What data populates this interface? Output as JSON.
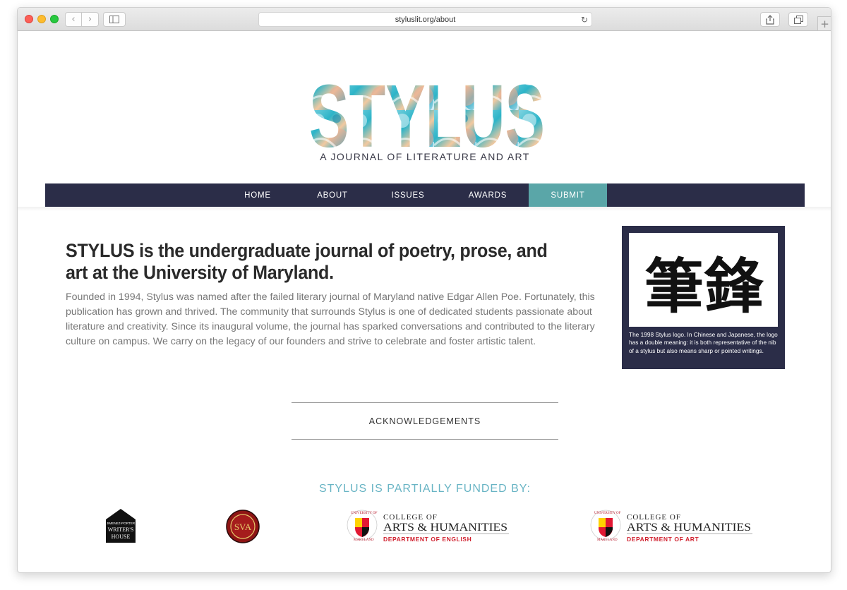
{
  "browser": {
    "url": "styluslit.org/about"
  },
  "header": {
    "logo_text": "STYLUS",
    "tagline": "A JOURNAL OF LITERATURE AND ART"
  },
  "nav": {
    "items": [
      {
        "label": "HOME"
      },
      {
        "label": "ABOUT"
      },
      {
        "label": "ISSUES"
      },
      {
        "label": "AWARDS"
      },
      {
        "label": "SUBMIT"
      }
    ],
    "highlight_color": "#5aa6a8",
    "bar_color": "#2b2d48"
  },
  "main": {
    "headline": "STYLUS is the undergraduate journal of poetry, prose, and art at the University of Maryland.",
    "intro": "Founded in 1994, Stylus was named after the failed literary journal of Maryland native Edgar Allen Poe. Fortunately, this publication has grown and thrived. The community that surrounds Stylus is one of dedicated students passionate about literature and creativity. Since its inaugural volume, the journal has sparked conversations and contributed to the literary culture on campus. We carry on the legacy of our founders and strive to celebrate and foster artistic talent."
  },
  "logo_card": {
    "characters": "筆鋒",
    "caption": "The 1998 Stylus logo. In Chinese and Japanese, the logo has a double meaning: it is both representative of the nib of a stylus but also means sharp or pointed writings."
  },
  "acknowledgements": {
    "label": "ACKNOWLEDGEMENTS"
  },
  "funding": {
    "heading": "STYLUS IS PARTIALLY FUNDED BY:",
    "sponsors": [
      {
        "name": "Jimenez-Porter Writers' House",
        "line1": "JIMENEZ-PORTER",
        "line2": "WRITER'S",
        "line3": "HOUSE"
      },
      {
        "name": "SVA seal",
        "monogram": "SVA"
      },
      {
        "name": "College of Arts & Humanities - Department of English",
        "seal_top": "UNIVERSITY OF",
        "seal_bottom": "MARYLAND",
        "line1": "COLLEGE OF",
        "line2": "ARTS & HUMANITIES",
        "line3": "DEPARTMENT OF ENGLISH"
      },
      {
        "name": "College of Arts & Humanities - Department of Art",
        "seal_top": "UNIVERSITY OF",
        "seal_bottom": "MARYLAND",
        "line1": "COLLEGE OF",
        "line2": "ARTS & HUMANITIES",
        "line3": "DEPARTMENT OF ART"
      }
    ]
  }
}
